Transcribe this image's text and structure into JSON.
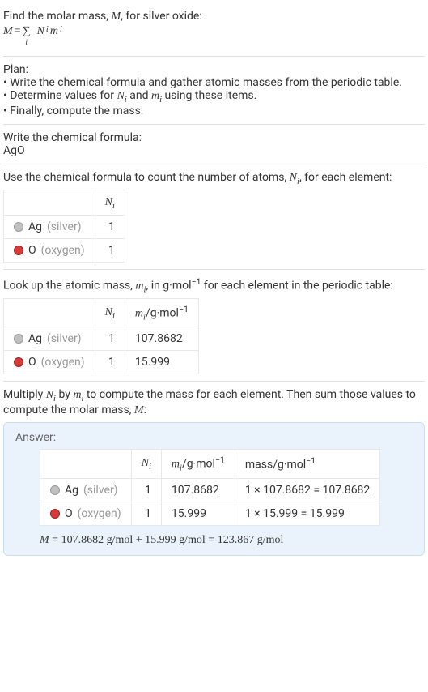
{
  "intro": {
    "line1_prefix": "Find the molar mass, ",
    "line1_var": "M",
    "line1_suffix": ", for silver oxide:",
    "eq_lhs": "M",
    "eq_eq": " = ",
    "sum": "∑",
    "sum_idx": "i",
    "eq_rhs1": "N",
    "eq_rhs1_sub": "i",
    "eq_rhs2": "m",
    "eq_rhs2_sub": "i"
  },
  "plan": {
    "title": "Plan:",
    "b1": "• Write the chemical formula and gather atomic masses from the periodic table.",
    "b2_prefix": "• Determine values for ",
    "b2_n": "N",
    "b2_ni": "i",
    "b2_and": " and ",
    "b2_m": "m",
    "b2_mi": "i",
    "b2_suffix": " using these items.",
    "b3": "• Finally, compute the mass."
  },
  "formula_section": {
    "title": "Write the chemical formula:",
    "formula": "AgO"
  },
  "count_section": {
    "title_prefix": "Use the chemical formula to count the number of atoms, ",
    "title_n": "N",
    "title_ni": "i",
    "title_suffix": ", for each element:",
    "header_n": "N",
    "header_ni": "i",
    "rows": [
      {
        "sym": "Ag",
        "name": "(silver)",
        "n": "1"
      },
      {
        "sym": "O",
        "name": "(oxygen)",
        "n": "1"
      }
    ]
  },
  "mass_section": {
    "title_prefix": "Look up the atomic mass, ",
    "title_m": "m",
    "title_mi": "i",
    "title_mid": ", in g·mol",
    "title_exp": "−1",
    "title_suffix": " for each element in the periodic table:",
    "header_n": "N",
    "header_ni": "i",
    "header_m": "m",
    "header_mi": "i",
    "header_unit": "/g·mol",
    "header_exp": "−1",
    "rows": [
      {
        "sym": "Ag",
        "name": "(silver)",
        "n": "1",
        "m": "107.8682"
      },
      {
        "sym": "O",
        "name": "(oxygen)",
        "n": "1",
        "m": "15.999"
      }
    ]
  },
  "multiply_section": {
    "text_prefix": "Multiply ",
    "n": "N",
    "ni": "i",
    "by": " by ",
    "m": "m",
    "mi": "i",
    "text_suffix": " to compute the mass for each element. Then sum those values to compute the molar mass, ",
    "Mvar": "M",
    "colon": ":"
  },
  "answer": {
    "label": "Answer:",
    "header_n": "N",
    "header_ni": "i",
    "header_m": "m",
    "header_mi": "i",
    "header_m_unit": "/g·mol",
    "header_exp": "−1",
    "header_mass": "mass/g·mol",
    "header_mass_exp": "−1",
    "rows": [
      {
        "sym": "Ag",
        "name": "(silver)",
        "n": "1",
        "m": "107.8682",
        "mass": "1 × 107.8682 = 107.8682"
      },
      {
        "sym": "O",
        "name": "(oxygen)",
        "n": "1",
        "m": "15.999",
        "mass": "1 × 15.999 = 15.999"
      }
    ],
    "final_M": "M",
    "final_eq": " = 107.8682 g/mol + 15.999 g/mol = 123.867 g/mol"
  }
}
